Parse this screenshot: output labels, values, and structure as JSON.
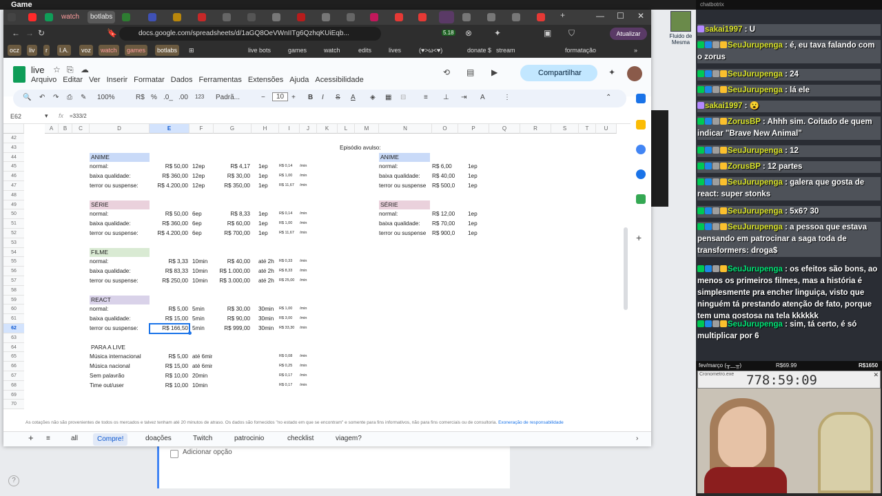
{
  "os_title": "Game",
  "browser": {
    "tabs": [
      "watch",
      "botlabs"
    ],
    "url": "docs.google.com/spreadsheets/d/1aGQ8OeVWnIITg6QzhqKUiEqb...",
    "update_label": "Atualizar",
    "extension_badge": "5.18"
  },
  "bookmarks": [
    "ocz",
    "liv",
    "r",
    "I.A.",
    "voz",
    "watch",
    "games",
    "botlabs",
    "live bots",
    "games",
    "watch",
    "edits",
    "lives",
    "(♥>ω<♥)",
    "donate $",
    "stream",
    "formatação"
  ],
  "sheet": {
    "title": "live",
    "menus": [
      "Arquivo",
      "Editar",
      "Ver",
      "Inserir",
      "Formatar",
      "Dados",
      "Ferramentas",
      "Extensões",
      "Ajuda",
      "Acessibilidade"
    ],
    "share_label": "Compartilhar",
    "zoom": "100%",
    "font": "Padrã...",
    "font_size": "10",
    "currency": "R$",
    "percent": "%",
    "dec_minus": ".0_",
    "dec_plus": ".00",
    "num_fmt": "123",
    "name_box": "E62",
    "formula": "=333/2",
    "columns": [
      "A",
      "B",
      "C",
      "D",
      "E",
      "F",
      "G",
      "H",
      "I",
      "J",
      "K",
      "L",
      "M",
      "N",
      "O",
      "P",
      "Q",
      "R",
      "S",
      "T",
      "U"
    ],
    "rows": [
      "42",
      "43",
      "44",
      "45",
      "46",
      "47",
      "48",
      "49",
      "50",
      "51",
      "52",
      "53",
      "54",
      "55",
      "56",
      "57",
      "58",
      "59",
      "60",
      "61",
      "62",
      "63",
      "64",
      "65",
      "66",
      "67",
      "68",
      "69",
      "70"
    ],
    "episodio_avulso": "Episódio avulso:",
    "left": {
      "anime": {
        "title": "ANIME",
        "rows": [
          [
            "normal:",
            "R$ 50,00",
            "12ep",
            "R$ 4,17",
            "1ep",
            "R$ 0,14",
            "/min"
          ],
          [
            "baixa qualidade:",
            "R$ 360,00",
            "12ep",
            "R$ 30,00",
            "1ep",
            "R$ 1,00",
            "/min"
          ],
          [
            "terror ou suspense:",
            "R$ 4.200,00",
            "12ep",
            "R$ 350,00",
            "1ep",
            "R$ 11,67",
            "/min"
          ]
        ]
      },
      "serie": {
        "title": "SÉRIE",
        "rows": [
          [
            "normal:",
            "R$ 50,00",
            "6ep",
            "R$ 8,33",
            "1ep",
            "R$ 0,14",
            "/min"
          ],
          [
            "baixa qualidade:",
            "R$ 360,00",
            "6ep",
            "R$ 60,00",
            "1ep",
            "R$ 1,00",
            "/min"
          ],
          [
            "terror ou suspense:",
            "R$ 4.200,00",
            "6ep",
            "R$ 700,00",
            "1ep",
            "R$ 11,67",
            "/min"
          ]
        ]
      },
      "filme": {
        "title": "FILME",
        "rows": [
          [
            "normal:",
            "R$ 3,33",
            "10min",
            "R$ 40,00",
            "até 2h",
            "R$ 0,33",
            "/min"
          ],
          [
            "baixa qualidade:",
            "R$ 83,33",
            "10min",
            "R$ 1.000,00",
            "até 2h",
            "R$ 8,33",
            "/min"
          ],
          [
            "terror ou suspense:",
            "R$ 250,00",
            "10min",
            "R$ 3.000,00",
            "até 2h",
            "R$ 25,00",
            "/min"
          ]
        ]
      },
      "react": {
        "title": "REACT",
        "rows": [
          [
            "normal:",
            "R$ 5,00",
            "5min",
            "R$ 30,00",
            "30min",
            "R$ 1,00",
            "/min"
          ],
          [
            "baixa qualidade:",
            "R$ 15,00",
            "5min",
            "R$ 90,00",
            "30min",
            "R$ 3,00",
            "/min"
          ],
          [
            "terror ou suspense:",
            "R$ 166,50",
            "5min",
            "R$ 999,00",
            "30min",
            "R$ 33,30",
            "/min"
          ]
        ]
      },
      "live": {
        "title": "PARA A LIVE",
        "rows": [
          [
            "Música internacional",
            "R$ 5,00",
            "até 6min",
            "R$ 0,08",
            "/min"
          ],
          [
            "Música nacional",
            "R$ 15,00",
            "até 6min",
            "R$ 0,25",
            "/min"
          ],
          [
            "Sem palavrão",
            "R$ 10,00",
            "20min",
            "R$ 0,17",
            "/min"
          ],
          [
            "Time out/user",
            "R$ 10,00",
            "10min",
            "R$ 0,17",
            "/min"
          ]
        ]
      }
    },
    "right": {
      "anime": {
        "title": "ANIME",
        "rows": [
          [
            "normal:",
            "R$ 6,00",
            "1ep"
          ],
          [
            "baixa qualidade:",
            "R$ 40,00",
            "1ep"
          ],
          [
            "terror ou suspense",
            "R$ 500,0",
            "1ep"
          ]
        ]
      },
      "serie": {
        "title": "SÉRIE",
        "rows": [
          [
            "normal:",
            "R$ 12,00",
            "1ep"
          ],
          [
            "baixa qualidade:",
            "R$ 70,00",
            "1ep"
          ],
          [
            "terror ou suspense",
            "R$ 900,0",
            "1ep"
          ]
        ]
      }
    },
    "disclaimer": "As cotações não são provenientes de todos os mercados e talvez tenham até 20 minutos de atraso. Os dados são fornecidos \"no estado em que se encontram\" e somente para fins informativos, não para fins comerciais ou de consultoria.",
    "disclaimer_link": "Exoneração de responsabilidade",
    "tabs": [
      "all",
      "Compre!",
      "doações",
      "Twitch",
      "patrocinio",
      "checklist",
      "viagem?"
    ],
    "active_tab": "Compre!"
  },
  "background_form": {
    "option": "Adicionar opção"
  },
  "desktop_icon": "Fluido de Mesma",
  "chat": {
    "header": "chatbotrix",
    "messages": [
      {
        "user": "sakai1997",
        "text": "U"
      },
      {
        "user": "SeuJurupenga",
        "text": "é, eu tava falando com o zorus"
      },
      {
        "user": "SeuJurupenga",
        "text": "24"
      },
      {
        "user": "SeuJurupenga",
        "text": "lá ele"
      },
      {
        "user": "sakai1997",
        "text": "😮"
      },
      {
        "user": "ZorusBP",
        "text": "Ahhh sim. Coitado de quem indicar \"Brave New Animal\""
      },
      {
        "user": "SeuJurupenga",
        "text": "12"
      },
      {
        "user": "ZorusBP",
        "text": "12 partes"
      },
      {
        "user": "SeuJurupenga",
        "text": "galera que gosta de react: super stonks"
      },
      {
        "user": "SeuJurupenga",
        "text": "5x6? 30"
      },
      {
        "user": "SeuJurupenga",
        "text": "a pessoa que estava pensando em patrocinar a saga toda de transformers: droga$"
      },
      {
        "user": "SeuJurupenga",
        "text": "os efeitos são bons, ao menos os primeiros filmes, mas a história é simplesmente pra encher linguiça, visto que ninguém tá prestando atenção de fato, porque tem uma gostosa na tela kkkkkk"
      },
      {
        "user": "SeuJurupenga",
        "text": "sim, tá certo, é só multiplicar por 6"
      }
    ]
  },
  "stream_overlay": {
    "month": "fev/março (╥﹏╥)",
    "current": "R$69.99",
    "goal": "R$1650"
  },
  "timer": {
    "label": "Cronometro.exe",
    "value": "778:59:09"
  }
}
